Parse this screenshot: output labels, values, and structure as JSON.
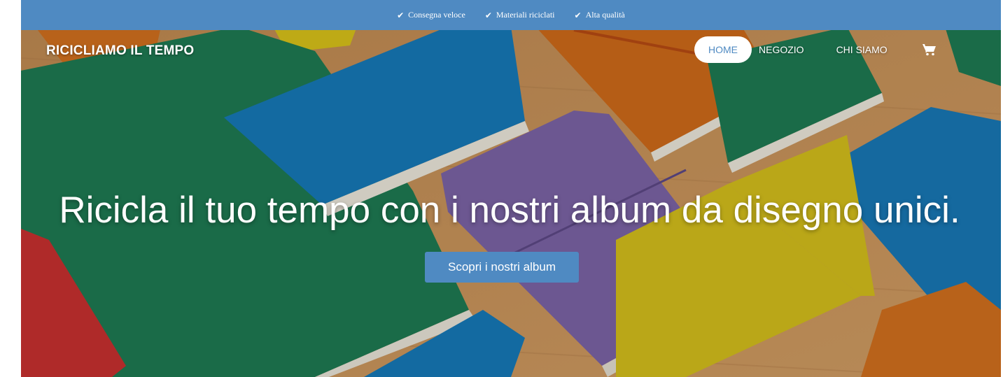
{
  "topbar": {
    "features": [
      {
        "icon": "check-icon",
        "label": "Consegna veloce"
      },
      {
        "icon": "check-icon",
        "label": "Materiali riciclati"
      },
      {
        "icon": "check-icon",
        "label": "Alta qualità"
      }
    ],
    "background": "#4f8ac2"
  },
  "nav": {
    "brand": "RICICLIAMO IL TEMPO",
    "items": [
      {
        "label": "HOME",
        "active": true
      },
      {
        "label": "NEGOZIO",
        "active": false
      },
      {
        "label": "CHI SIAMO",
        "active": false
      }
    ],
    "cart_icon": "cart-icon"
  },
  "hero": {
    "headline": "Ricicla il tuo tempo con i nostri album da disegno unici.",
    "cta_label": "Scopri i nostri album",
    "accent": "#4f8ac2"
  }
}
